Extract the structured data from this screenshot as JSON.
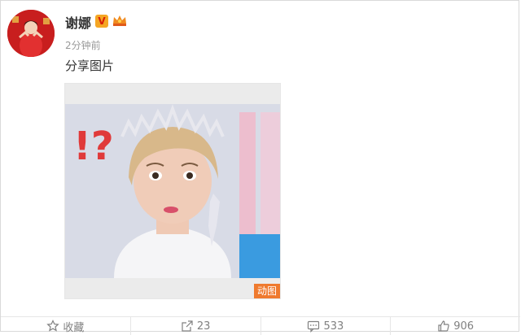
{
  "post": {
    "username": "谢娜",
    "verified_badge": "V",
    "timestamp": "2分钟前",
    "text": "分享图片",
    "media_label": "动图",
    "media_overlay_text": "!?"
  },
  "actions": {
    "favorite": {
      "label": "收藏",
      "icon": "star-icon"
    },
    "repost": {
      "label": "23",
      "icon": "share-icon"
    },
    "comment": {
      "label": "533",
      "icon": "comment-icon"
    },
    "like": {
      "label": "906",
      "icon": "thumbs-up-icon"
    }
  },
  "colors": {
    "badge": "#f5a623",
    "gif_label": "#ef7a2e",
    "avatar_bg": "#c81e1e"
  }
}
